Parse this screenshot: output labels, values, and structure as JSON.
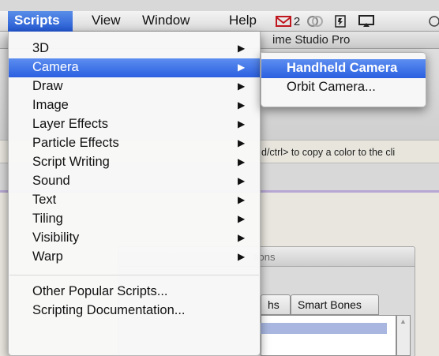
{
  "background": {
    "window_title": "ime Studio Pro",
    "hint_text": "d/ctrl> to copy a color to the cli",
    "panel_title": "tions",
    "tabs": [
      "hs",
      "Smart Bones"
    ]
  },
  "menubar": {
    "items": [
      "Scripts",
      "View",
      "Window",
      "Help"
    ],
    "active": "Scripts",
    "status": {
      "mail_icon": "mail-icon",
      "mail_count": "2",
      "icons": [
        "record-icon",
        "battery-icon",
        "airplay-icon",
        "search-icon"
      ]
    }
  },
  "scripts_menu": {
    "items": [
      {
        "label": "3D",
        "submenu": true
      },
      {
        "label": "Camera",
        "submenu": true,
        "highlighted": true
      },
      {
        "label": "Draw",
        "submenu": true
      },
      {
        "label": "Image",
        "submenu": true
      },
      {
        "label": "Layer Effects",
        "submenu": true
      },
      {
        "label": "Particle Effects",
        "submenu": true
      },
      {
        "label": "Script Writing",
        "submenu": true
      },
      {
        "label": "Sound",
        "submenu": true
      },
      {
        "label": "Text",
        "submenu": true
      },
      {
        "label": "Tiling",
        "submenu": true
      },
      {
        "label": "Visibility",
        "submenu": true
      },
      {
        "label": "Warp",
        "submenu": true
      }
    ],
    "bottom_items": [
      {
        "label": "Other Popular Scripts..."
      },
      {
        "label": "Scripting Documentation..."
      }
    ],
    "arrow_glyph": "▶"
  },
  "camera_submenu": {
    "items": [
      {
        "label": "Handheld Camera",
        "highlighted": true
      },
      {
        "label": "Orbit Camera..."
      }
    ]
  },
  "colors": {
    "highlight": "#2b5fe0"
  }
}
